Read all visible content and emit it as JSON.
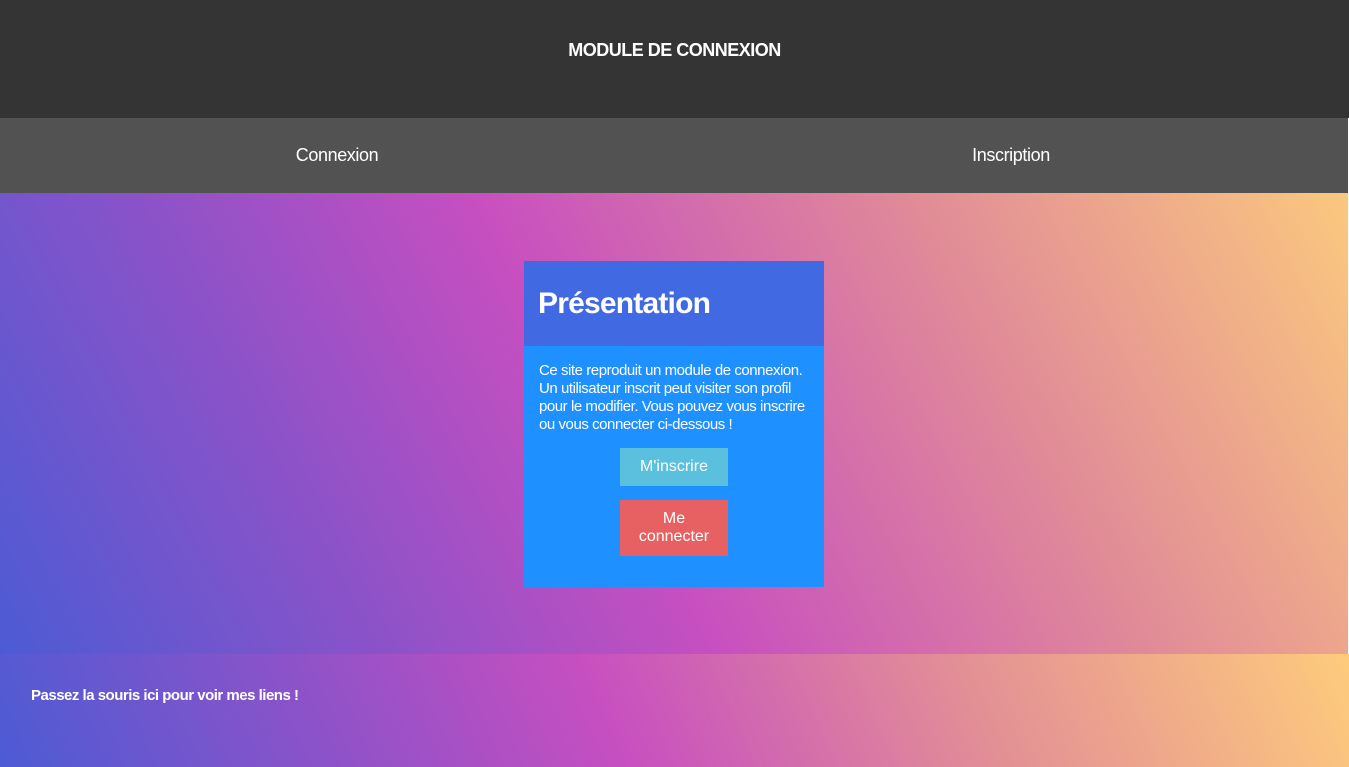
{
  "header": {
    "title": "MODULE DE CONNEXION"
  },
  "nav": {
    "items": [
      {
        "label": "Connexion"
      },
      {
        "label": "Inscription"
      }
    ]
  },
  "card": {
    "title": "Présentation",
    "text": "Ce site reproduit un module de connexion. Un utilisateur inscrit peut visiter son profil pour le modifier. Vous pouvez vous inscrire ou vous connecter ci-dessous !",
    "signup_label": "M'inscrire",
    "login_label": "Me connecter"
  },
  "footer": {
    "text": "Passez la souris ici pour voir mes liens !"
  },
  "colors": {
    "header_bg": "#343434",
    "nav_bg": "#525252",
    "card_head_bg": "#4169e1",
    "card_body_bg": "#1e90ff",
    "signup_button": "#5bc0de",
    "login_button": "#e76162"
  }
}
